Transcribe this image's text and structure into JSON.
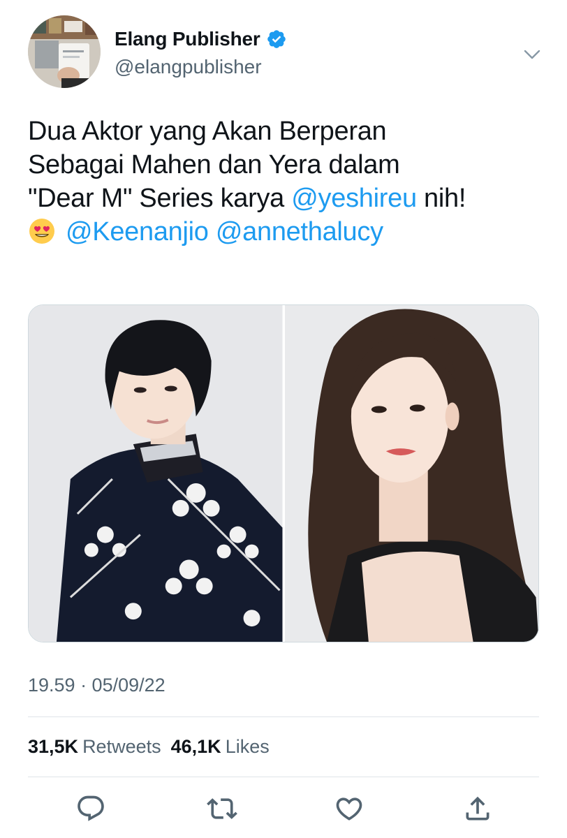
{
  "author": {
    "display_name": "Elang Publisher",
    "handle": "@elangpublisher",
    "verified": true,
    "avatar_icon": "avatar-photo",
    "verified_icon": "verified-badge-icon",
    "verified_color": "#1d9bf0"
  },
  "menu_icon": "chevron-down-icon",
  "text": {
    "line1": "Dua Aktor yang Akan Berperan",
    "line2": "Sebagai Mahen dan Yera dalam",
    "line3_prefix": "\"Dear M\" Series karya ",
    "line3_mention": "@yeshireu",
    "line3_suffix": " nih!",
    "line4_emoji": "smiling-face-with-heart-eyes",
    "line4_mention1": "@Keenanjio",
    "line4_mention2": "@annethalucy"
  },
  "media": {
    "photos": [
      {
        "icon": "photo-actor"
      },
      {
        "icon": "photo-actress"
      }
    ]
  },
  "timestamp": "19.59 · 05/09/22",
  "stats": {
    "retweets_count": "31,5K",
    "retweets_label": "Retweets",
    "likes_count": "46,1K",
    "likes_label": "Likes"
  },
  "actions": [
    {
      "icon": "reply-icon"
    },
    {
      "icon": "retweet-icon"
    },
    {
      "icon": "like-icon"
    },
    {
      "icon": "share-icon"
    }
  ],
  "colors": {
    "text": "#0f1419",
    "secondary": "#536471",
    "link": "#1d9bf0",
    "icon": "#536471"
  }
}
